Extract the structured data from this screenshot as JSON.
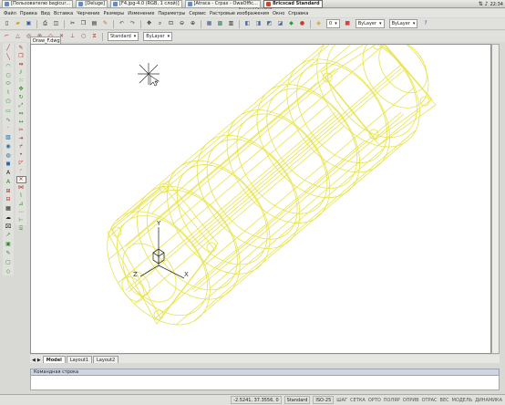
{
  "taskbar": {
    "tasks": [
      {
        "label": "[Пользователю bagicur…"
      },
      {
        "label": "[Deluge]"
      },
      {
        "label": "[F4.jpg-4.0 (RGB, 1 слой)]"
      },
      {
        "label": "[Atraca - Crpax - OwaOffic…"
      },
      {
        "label": "Bricscad Standard"
      }
    ],
    "clock": "22:34"
  },
  "window_title": "Bricscad Standard",
  "menu": [
    "Файл",
    "Правка",
    "Вид",
    "Вставка",
    "Черчение",
    "Размеры",
    "Изменение",
    "Параметры",
    "Сервис",
    "Растровые изображения",
    "Окно",
    "Справка"
  ],
  "toolbar": {
    "layer_combo": "0",
    "style_combo": "Standard",
    "linetype_combo": "ByLayer",
    "lineweight_combo": "ByLayer",
    "color_combo": "ByLayer"
  },
  "drawing": {
    "tab": "Draw_F.dwg",
    "wire_color": "#e8e34a",
    "ucs": {
      "x": "X",
      "y": "Y",
      "z": "Z"
    }
  },
  "layout_tabs": [
    "Model",
    "Layout1",
    "Layout2"
  ],
  "command": {
    "header": "Командная строка"
  },
  "status": {
    "coords": "-2.5241, 37.3556, 0",
    "style": "Standard",
    "dimstyle": "ISO-25",
    "toggles": [
      "ШАГ",
      "СЕТКА",
      "ОРТО",
      "ПОЛЯР",
      "ОПРИВ",
      "ОТРАС",
      "ВЕС",
      "МОДЕЛЬ",
      "ДИНВВОД"
    ],
    "model_label": "ДИНАМИКА"
  }
}
